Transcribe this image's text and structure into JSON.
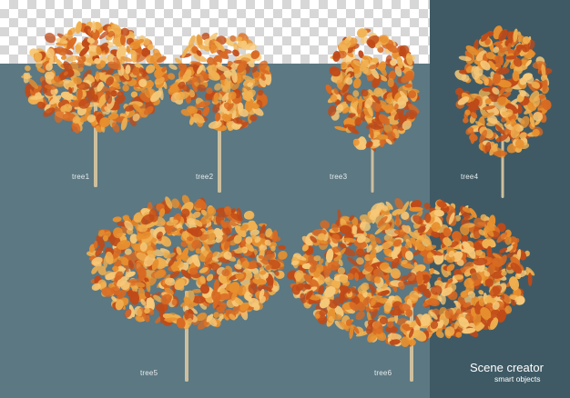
{
  "scene": {
    "background_colors": {
      "checker_light": "#ffffff",
      "checker_dark": "#d7d7d7",
      "teal": "#5c7882",
      "panel": "#3f5a65",
      "foliage": [
        "#f0b050",
        "#e8902e",
        "#d96a22",
        "#c04a18",
        "#f6c878"
      ],
      "trunk": "#cdbf9e"
    }
  },
  "trees": [
    {
      "label": "tree1",
      "style": "round-crown"
    },
    {
      "label": "tree2",
      "style": "round-crown"
    },
    {
      "label": "tree3",
      "style": "narrow-crown"
    },
    {
      "label": "tree4",
      "style": "narrow-crown"
    },
    {
      "label": "tree5",
      "style": "wide-crown"
    },
    {
      "label": "tree6",
      "style": "wide-crown"
    }
  ],
  "brand": {
    "title": "Scene creator",
    "subtitle": "smart objects"
  }
}
